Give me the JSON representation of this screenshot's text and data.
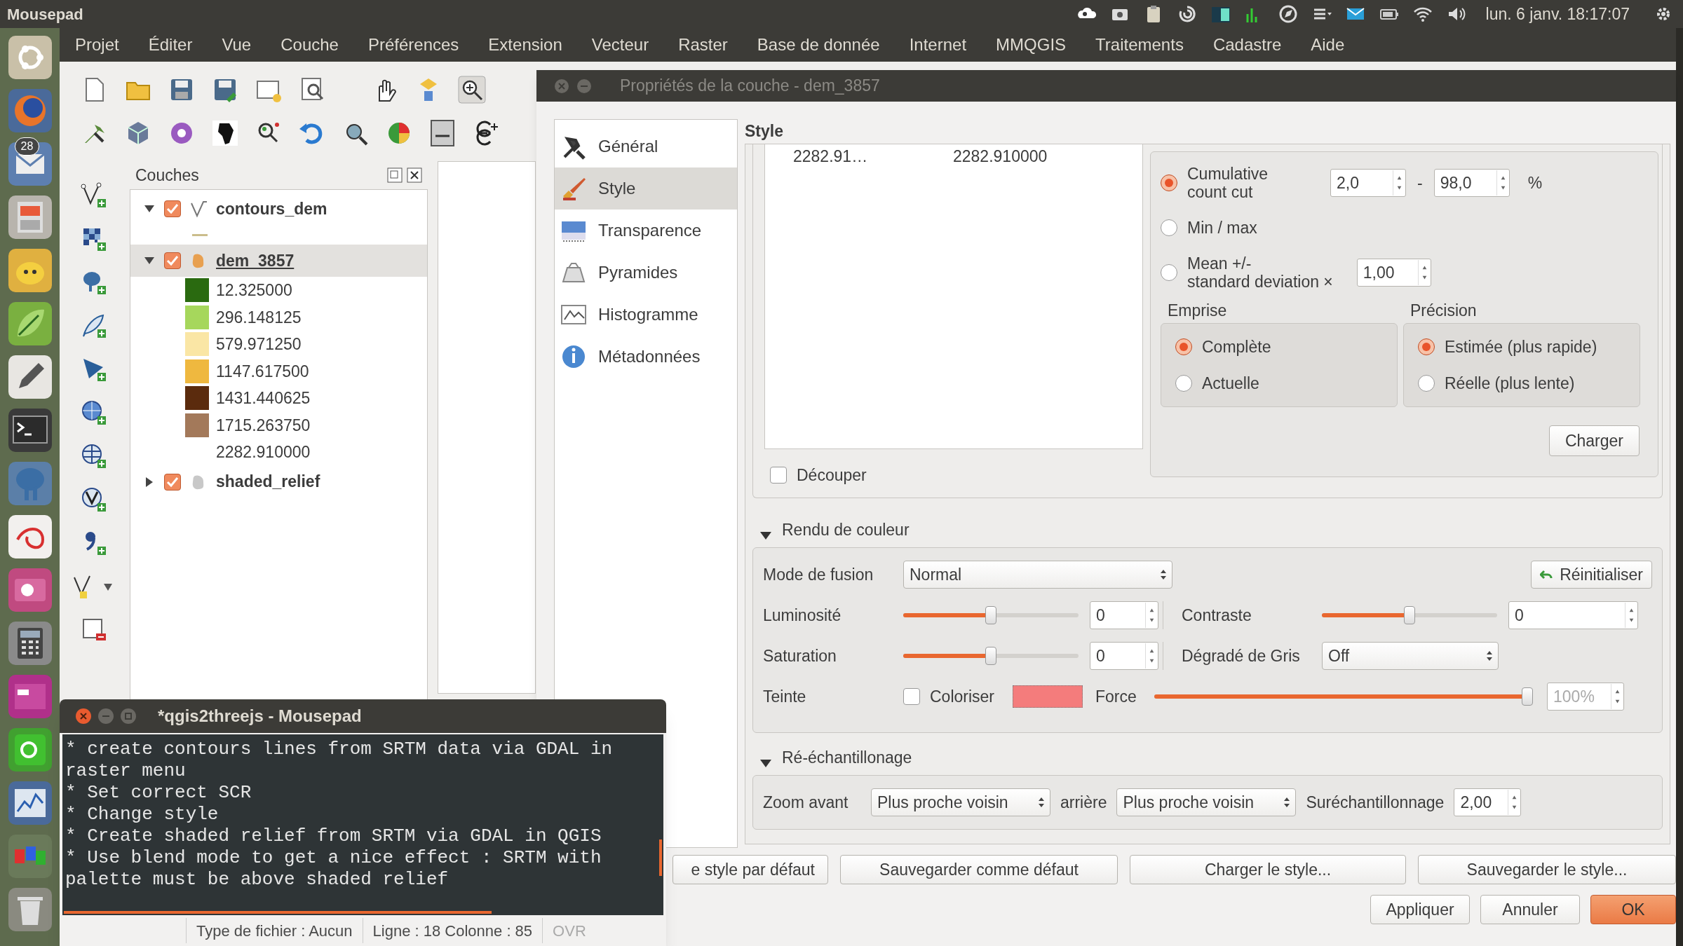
{
  "top_bar": {
    "app_name": "Mousepad",
    "clock": "lun. 6 janv. 18:17:07"
  },
  "launcher": {
    "badge": "28"
  },
  "menu_bar": [
    "Projet",
    "Éditer",
    "Vue",
    "Couche",
    "Préférences",
    "Extension",
    "Vecteur",
    "Raster",
    "Base de donnée",
    "Internet",
    "MMQGIS",
    "Traitements",
    "Cadastre",
    "Aide"
  ],
  "layers_panel": {
    "title": "Couches",
    "layers": [
      {
        "name": "contours_dem",
        "kind": "vector",
        "checked": true,
        "expanded": true,
        "selected": false,
        "legend": [
          {
            "kind": "line",
            "color": "#cbbd8c"
          }
        ]
      },
      {
        "name": "dem_3857",
        "kind": "raster",
        "checked": true,
        "expanded": true,
        "selected": true,
        "legend": [
          {
            "kind": "swatch",
            "label": "12.325000",
            "color": "#2a6a10"
          },
          {
            "kind": "swatch",
            "label": "296.148125",
            "color": "#a6d75c"
          },
          {
            "kind": "swatch",
            "label": "579.971250",
            "color": "#fae6a5"
          },
          {
            "kind": "swatch",
            "label": "1147.617500",
            "color": "#efb83f"
          },
          {
            "kind": "swatch",
            "label": "1431.440625",
            "color": "#5b2b0d"
          },
          {
            "kind": "swatch",
            "label": "1715.263750",
            "color": "#a3795a"
          },
          {
            "kind": "plain",
            "label": "2282.910000"
          }
        ]
      },
      {
        "name": "shaded_relief",
        "kind": "raster",
        "checked": true,
        "expanded": false,
        "selected": false
      }
    ]
  },
  "dialog": {
    "title": "Propriétés de la couche - dem_3857",
    "sections": [
      {
        "label": "Général",
        "selected": false
      },
      {
        "label": "Style",
        "selected": true
      },
      {
        "label": "Transparence",
        "selected": false
      },
      {
        "label": "Pyramides",
        "selected": false
      },
      {
        "label": "Histogramme",
        "selected": false
      },
      {
        "label": "Métadonnées",
        "selected": false
      }
    ],
    "page_title": "Style",
    "value_list": [
      {
        "column_1": "2282.91…",
        "column_2": "2282.910000"
      }
    ],
    "clip": {
      "label": "Découper",
      "checked": false
    },
    "min_max": {
      "options": [
        {
          "label": "Cumulative\ncount cut",
          "selected": true
        },
        {
          "label": "Min / max",
          "selected": false
        },
        {
          "label": "Mean +/-\nstandard deviation ×",
          "selected": false
        }
      ],
      "cut_from": "2,0",
      "dash": "-",
      "cut_to": "98,0",
      "percent": "%",
      "std_dev": "1,00"
    },
    "extent": {
      "title": "Emprise",
      "options": [
        {
          "label": "Complète",
          "selected": true
        },
        {
          "label": "Actuelle",
          "selected": false
        }
      ]
    },
    "accuracy": {
      "title": "Précision",
      "options": [
        {
          "label": "Estimée (plus rapide)",
          "selected": true
        },
        {
          "label": "Réelle (plus lente)",
          "selected": false
        }
      ]
    },
    "load_button": "Charger",
    "color_rendering": {
      "title": "Rendu de couleur",
      "expanded": true,
      "blend_label": "Mode de fusion",
      "blend_value": "Normal",
      "reset_button": "Réinitialiser",
      "brightness": {
        "label": "Luminosité",
        "level": 0.5,
        "value": "0"
      },
      "contrast": {
        "label": "Contraste",
        "level": 0.5,
        "value": "0"
      },
      "saturation": {
        "label": "Saturation",
        "level": 0.5,
        "value": "0"
      },
      "grayscale": {
        "label": "Dégradé de Gris",
        "value": "Off"
      },
      "hue": {
        "label": "Teinte",
        "colorize_label": "Coloriser",
        "colorize": false,
        "color": "#f47c7c",
        "strength_label": "Force",
        "level": 1.0,
        "value": "100%",
        "disabled": true
      }
    },
    "resampling": {
      "title": "Ré-échantillonage",
      "expanded": true,
      "zoom_in_label": "Zoom avant",
      "zoom_in": "Plus proche voisin",
      "zoom_out_label": "arrière",
      "zoom_out": "Plus proche voisin",
      "oversampling_label": "Suréchantillonnage",
      "oversampling": "2,00"
    },
    "style_buttons": [
      "e style par défaut",
      "Sauvegarder comme défaut",
      "Charger le style...",
      "Sauvegarder le style..."
    ],
    "buttons": [
      {
        "label": "Appliquer",
        "kind": "normal"
      },
      {
        "label": "Annuler",
        "kind": "normal"
      },
      {
        "label": "OK",
        "kind": "default"
      }
    ]
  },
  "editor": {
    "title": "*qgis2threejs - Mousepad",
    "lines": [
      "* create contours lines from SRTM data via GDAL in",
      "raster menu",
      "* Set correct SCR",
      "* Change style",
      "* Create shaded relief from SRTM via GDAL in QGIS",
      "* Use blend mode to get a nice effect : SRTM with",
      "palette must be above shaded relief"
    ],
    "status": [
      "Type de fichier : Aucun",
      "Ligne : 18 Colonne : 85",
      "OVR"
    ]
  }
}
